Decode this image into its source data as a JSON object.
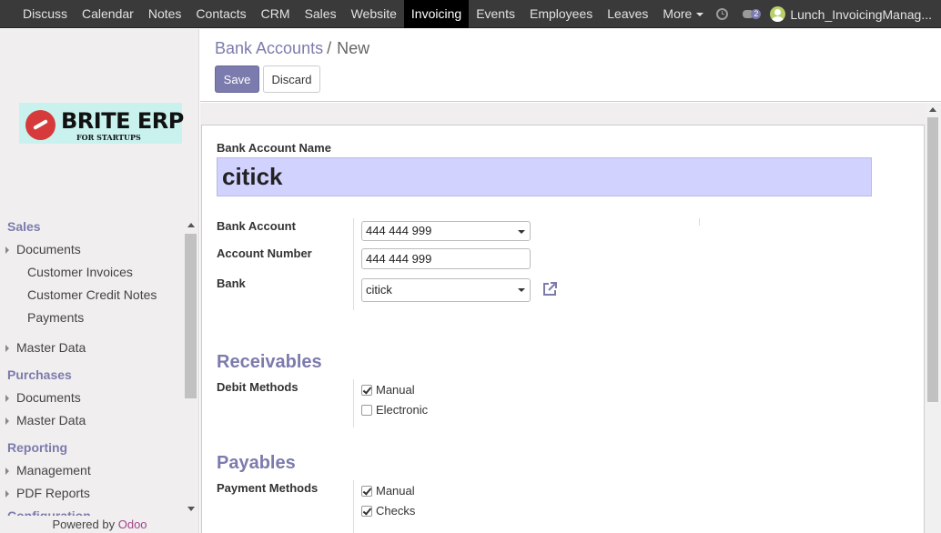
{
  "topbar": {
    "menu": [
      "Discuss",
      "Calendar",
      "Notes",
      "Contacts",
      "CRM",
      "Sales",
      "Website",
      "Invoicing",
      "Events",
      "Employees",
      "Leaves"
    ],
    "active": "Invoicing",
    "more_label": "More",
    "chat_count": "2",
    "user_name": "Lunch_InvoicingManag..."
  },
  "logo": {
    "brand": "BRITE ERP",
    "tagline": "FOR STARTUPS"
  },
  "sidebar": {
    "sales": "Sales",
    "sales_documents": "Documents",
    "customer_invoices": "Customer Invoices",
    "customer_credit_notes": "Customer Credit Notes",
    "payments": "Payments",
    "sales_master_data": "Master Data",
    "purchases": "Purchases",
    "purchases_documents": "Documents",
    "purchases_master_data": "Master Data",
    "reporting": "Reporting",
    "management": "Management",
    "pdf_reports": "PDF Reports",
    "configuration": "Configuration"
  },
  "footer": {
    "powered_by": "Powered by",
    "odoo": "Odoo"
  },
  "breadcrumb": {
    "parent": "Bank Accounts",
    "separator": "/",
    "current": "New"
  },
  "buttons": {
    "save": "Save",
    "discard": "Discard"
  },
  "form": {
    "name_label": "Bank Account Name",
    "name_value": "citick",
    "bank_account_label": "Bank Account",
    "bank_account_value": "444 444 999",
    "account_number_label": "Account Number",
    "account_number_value": "444 444 999",
    "bank_label": "Bank",
    "bank_value": "citick",
    "receivables_title": "Receivables",
    "debit_methods_label": "Debit Methods",
    "debit_manual": "Manual",
    "debit_electronic": "Electronic",
    "payables_title": "Payables",
    "payment_methods_label": "Payment Methods",
    "payment_manual": "Manual",
    "payment_checks": "Checks"
  },
  "colors": {
    "accent": "#7c7bad",
    "topbar": "#3a3a3a",
    "name_field_bg": "#d2d2ff",
    "odoo_brand": "#a24689"
  }
}
